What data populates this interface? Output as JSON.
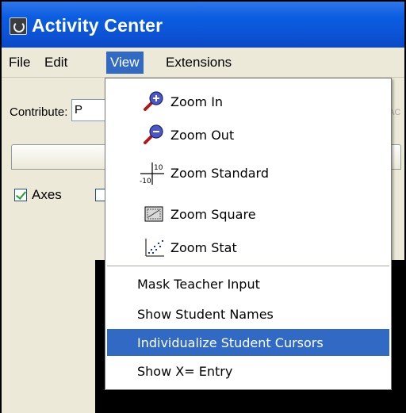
{
  "window": {
    "title": "Activity Center"
  },
  "menubar": {
    "items": [
      {
        "label": "File",
        "active": false
      },
      {
        "label": "Edit",
        "active": false
      },
      {
        "label": "View",
        "active": true
      },
      {
        "label": "Extensions",
        "active": false
      }
    ]
  },
  "toolbar": {
    "contribute_label": "Contribute:",
    "contribute_value": "P",
    "right_hint": "AC"
  },
  "options": {
    "axes_label": "Axes",
    "axes_checked": true,
    "second_checked": false
  },
  "view_menu": {
    "zoom_in": "Zoom In",
    "zoom_out": "Zoom Out",
    "zoom_standard": "Zoom Standard",
    "zoom_standard_icon_top": "10",
    "zoom_standard_icon_bottom": "-10",
    "zoom_square": "Zoom Square",
    "zoom_stat": "Zoom Stat",
    "mask_teacher_input": "Mask Teacher Input",
    "show_student_names": "Show Student Names",
    "individualize_student_cursors": "Individualize Student Cursors",
    "show_x_entry": "Show X= Entry",
    "highlighted": "Individualize Student Cursors"
  },
  "colors": {
    "titlebar": "#0a5ce0",
    "menu_highlight": "#316ac5",
    "window_face": "#ece9d8"
  }
}
